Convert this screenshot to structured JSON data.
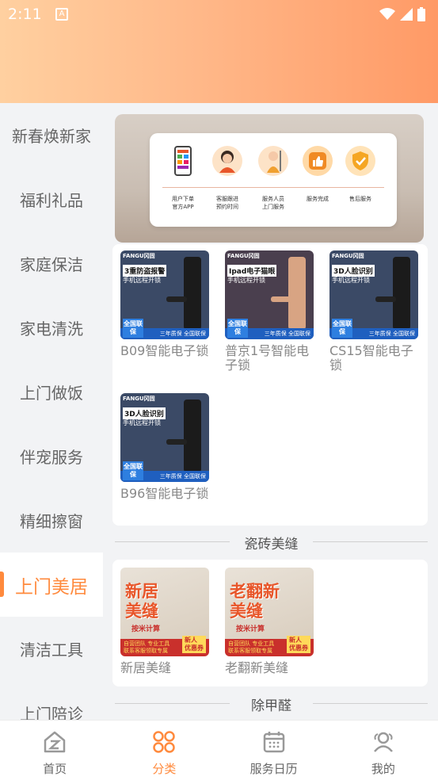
{
  "status_bar": {
    "time": "2:11",
    "notification_icon": "A"
  },
  "sidebar": {
    "items": [
      {
        "label": "新春焕新家"
      },
      {
        "label": "福利礼品"
      },
      {
        "label": "家庭保洁"
      },
      {
        "label": "家电清洗"
      },
      {
        "label": "上门做饭"
      },
      {
        "label": "伴宠服务"
      },
      {
        "label": "精细擦窗"
      },
      {
        "label": "上门美居",
        "active": true
      },
      {
        "label": "清洁工具"
      },
      {
        "label": "上门陪诊"
      }
    ]
  },
  "banner": {
    "steps": [
      {
        "line1": "用户下单",
        "line2": "官方APP",
        "icon": "phone-icon"
      },
      {
        "line1": "客服跟进",
        "line2": "预约时间",
        "icon": "agent-icon"
      },
      {
        "line1": "服务人员",
        "line2": "上门服务",
        "icon": "cleaner-icon"
      },
      {
        "line1": "服务完成",
        "line2": "",
        "icon": "thumbs-up-icon"
      },
      {
        "line1": "售后服务",
        "line2": "",
        "icon": "shield-check-icon"
      }
    ]
  },
  "lock_products": [
    {
      "name": "B09智能电子锁",
      "brand": "FANGU冈固",
      "headline": "3重防盗报警",
      "sub": "手机远程开锁",
      "footer": "三年质保 全国联保",
      "badge": "全国联保"
    },
    {
      "name": "普京1号智能电子锁",
      "brand": "FANGU冈固",
      "headline": "Ipad电子猫眼",
      "sub": "手机远程开锁",
      "footer": "三年质保 全国联保",
      "badge": "全国联保"
    },
    {
      "name": "CS15智能电子锁",
      "brand": "FANGU冈固",
      "headline": "3D人脸识别",
      "sub": "手机远程开锁",
      "footer": "三年质保 全国联保",
      "badge": "全国联保"
    },
    {
      "name": "B96智能电子锁",
      "brand": "FANGU冈固",
      "headline": "3D人脸识别",
      "sub": "手机远程开锁",
      "footer": "三年质保 全国联保",
      "badge": "全国联保"
    }
  ],
  "sections": {
    "tile_seam": "瓷砖美缝",
    "formaldehyde": "除甲醛"
  },
  "tile_products": [
    {
      "name": "新居美缝",
      "title_line1": "新居",
      "title_line2": "美缝",
      "sub": "按米计算",
      "foot_line1": "自营团队 专业工具",
      "foot_line2": "联系客服领取专属",
      "coupon_line1": "新人",
      "coupon_line2": "优惠券"
    },
    {
      "name": "老翻新美缝",
      "title_line1": "老翻新",
      "title_line2": "美缝",
      "sub": "按米计算",
      "foot_line1": "自营团队 专业工具",
      "foot_line2": "联系客服领取专属",
      "coupon_line1": "新人",
      "coupon_line2": "优惠券"
    }
  ],
  "tabbar": {
    "tabs": [
      {
        "label": "首页",
        "icon": "home-icon"
      },
      {
        "label": "分类",
        "icon": "category-icon",
        "active": true
      },
      {
        "label": "服务日历",
        "icon": "calendar-icon"
      },
      {
        "label": "我的",
        "icon": "profile-icon"
      }
    ]
  },
  "colors": {
    "accent": "#ff8a3d",
    "header_start": "#ffd0a0",
    "header_end": "#ff9a66"
  }
}
